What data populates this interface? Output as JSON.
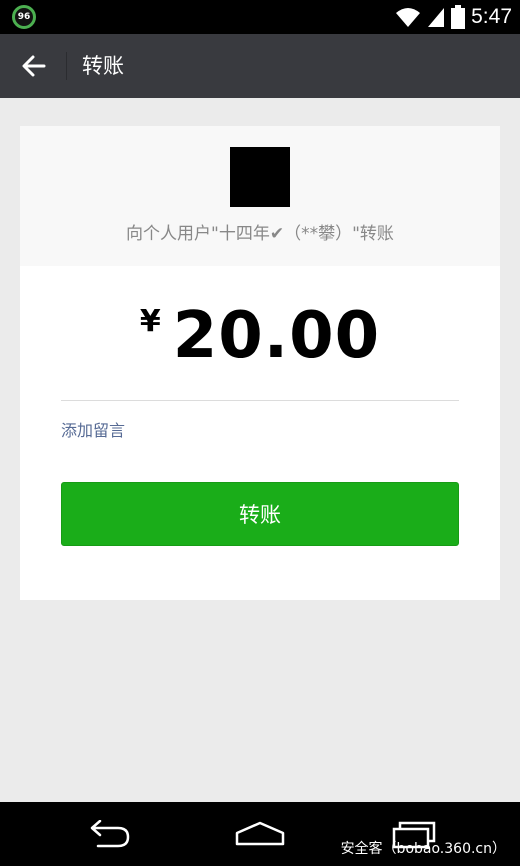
{
  "status_bar": {
    "badge": "96",
    "time": "5:47"
  },
  "header": {
    "title": "转账"
  },
  "transfer": {
    "recipient_line": "向个人用户\"十四年✔（**攀）\"转账",
    "currency_symbol": "¥",
    "amount": "20.00",
    "add_note_label": "添加留言",
    "submit_label": "转账"
  },
  "watermark": "安全客（bobao.360.cn）",
  "colors": {
    "title_bar": "#393a3f",
    "primary_button": "#1aad19",
    "link": "#576b95",
    "background": "#ebebeb"
  }
}
